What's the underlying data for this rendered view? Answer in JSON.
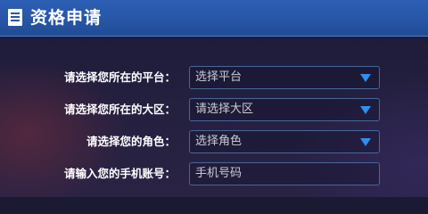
{
  "header": {
    "title": "资格申请",
    "icon": "list-document-icon"
  },
  "form": {
    "platform": {
      "label": "请选择您所在的平台：",
      "value": "选择平台",
      "icon": "caret-down-icon"
    },
    "region": {
      "label": "请选择您所在的大区：",
      "value": "请选择大区",
      "icon": "caret-down-icon"
    },
    "role": {
      "label": "请选择您的角色：",
      "value": "选择角色",
      "icon": "caret-down-icon"
    },
    "phone": {
      "label": "请输入您的手机账号：",
      "placeholder": "手机号码"
    }
  },
  "colors": {
    "header_blue": "#2655a4",
    "accent_caret": "#2f8ef0",
    "field_border": "#46679c"
  }
}
